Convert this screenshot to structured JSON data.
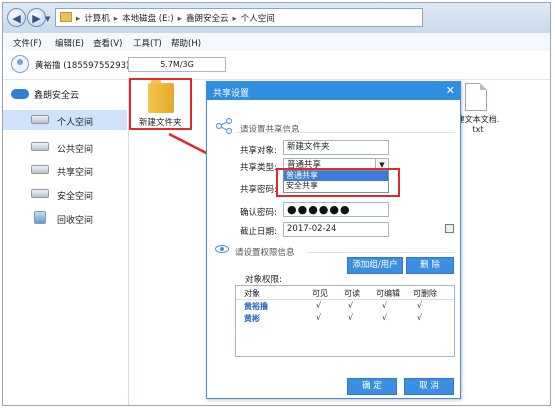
{
  "address_bar": {
    "crumbs": [
      "计算机",
      "本地磁盘 (E:)",
      "鑫朗安全云",
      "个人空间"
    ]
  },
  "menu": [
    "文件(F)",
    "编辑(E)",
    "查看(V)",
    "工具(T)",
    "帮助(H)"
  ],
  "user": {
    "name": "黄裕撸 (18559755293)",
    "quota": "5.7M/3G"
  },
  "sidebar": {
    "root": "鑫朗安全云",
    "items": [
      {
        "label": "个人空间",
        "active": true,
        "icon": "drive-icon"
      },
      {
        "label": "公共空间",
        "active": false,
        "icon": "drive-icon"
      },
      {
        "label": "共享空间",
        "active": false,
        "icon": "drive-icon"
      },
      {
        "label": "安全空间",
        "active": false,
        "icon": "drive-icon"
      },
      {
        "label": "回收空间",
        "active": false,
        "icon": "recycle-icon"
      }
    ]
  },
  "files": [
    {
      "name": "新建文件夹",
      "type": "folder"
    },
    {
      "name": "建文本文档.\ntxt",
      "type": "text-document"
    }
  ],
  "dialog": {
    "title": "共享设置",
    "close": "✕",
    "share_section": "请设置共享信息",
    "fields": {
      "object_label": "共享对象:",
      "object_value": "新建文件夹",
      "type_label": "共享类型:",
      "type_value": "普通共享",
      "type_options": [
        "普通共享",
        "安全共享"
      ],
      "password_label": "共享密码:",
      "confirm_label": "确认密码:",
      "confirm_value": "●●●●●●",
      "expiry_label": "截止日期:",
      "expiry_value": "2017-02-24"
    },
    "permission_section": "请设置权限信息",
    "add_button": "添加组/用户",
    "delete_button": "删 除",
    "permission_label": "对象权限:",
    "table": {
      "headers": [
        "对象",
        "可见",
        "可读",
        "可编辑",
        "可删除"
      ],
      "rows": [
        {
          "object": "黄裕撸",
          "cells": [
            "√",
            "√",
            "√",
            "√"
          ]
        },
        {
          "object": "黄彬",
          "cells": [
            "√",
            "√",
            "√",
            "√"
          ]
        }
      ]
    },
    "ok_button": "确 定",
    "cancel_button": "取 消"
  },
  "colors": {
    "accent": "#2f8ee0",
    "highlight": "#e0292b"
  }
}
